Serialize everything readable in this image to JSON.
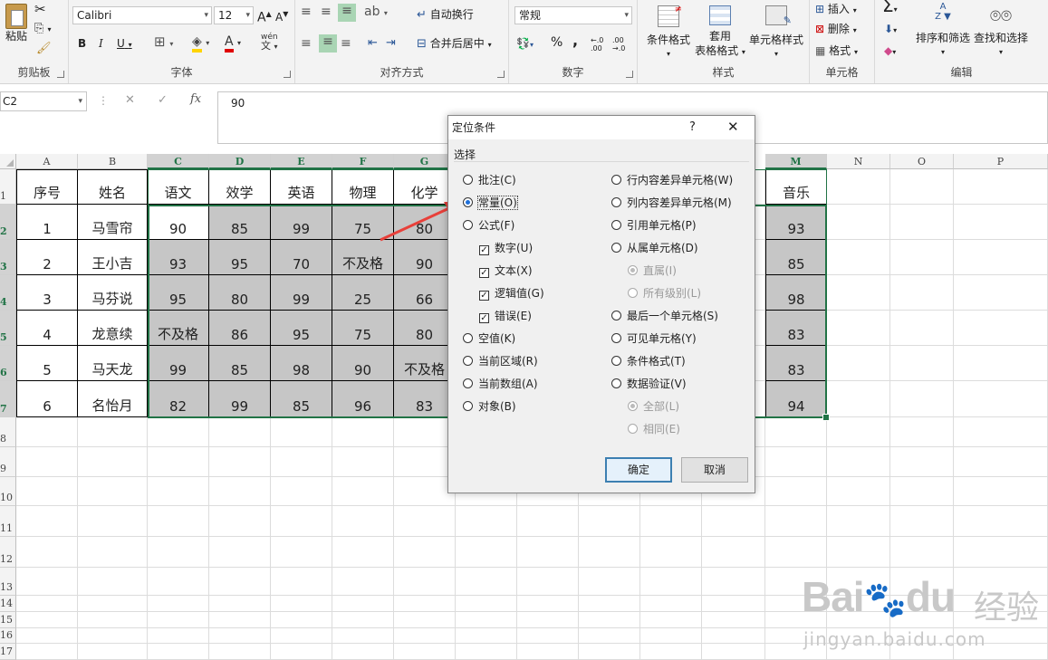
{
  "ribbon": {
    "clipboard": {
      "paste": "粘贴",
      "label": "剪贴板"
    },
    "font": {
      "name": "Calibri",
      "size": "12",
      "label": "字体",
      "bold": "B",
      "italic": "I",
      "underline": "U",
      "grow": "A",
      "shrink": "A",
      "color": "A",
      "phonetic": "wén"
    },
    "alignment": {
      "wrap": "自动换行",
      "merge": "合并后居中",
      "label": "对齐方式"
    },
    "number": {
      "format": "常规",
      "label": "数字",
      "percent": "%",
      "comma": ",",
      "inc": "←.0 .00",
      "dec": ".00 →.0"
    },
    "styles": {
      "conditional": "条件格式",
      "table_line1": "套用",
      "table_line2": "表格格式",
      "cell_styles": "单元格样式",
      "label": "样式"
    },
    "cells": {
      "insert": "插入",
      "delete": "删除",
      "format": "格式",
      "label": "单元格"
    },
    "editing": {
      "sigma": "Σ",
      "sort": "排序和筛选",
      "find": "查找和选择",
      "label": "编辑"
    }
  },
  "formula_bar": {
    "name_box": "C2",
    "cancel": "✕",
    "enter": "✓",
    "fx": "fx",
    "value": "90"
  },
  "columns": [
    "A",
    "B",
    "C",
    "D",
    "E",
    "F",
    "G",
    "N",
    "O",
    "P"
  ],
  "selected_last_col": "M",
  "rows": [
    {
      "n": "1",
      "cells": [
        "序号",
        "姓名",
        "语文",
        "效学",
        "英语",
        "物理",
        "化学"
      ],
      "last": "音乐"
    },
    {
      "n": "2",
      "cells": [
        "1",
        "马雪帘",
        "90",
        "85",
        "99",
        "75",
        "80"
      ],
      "last": "93"
    },
    {
      "n": "3",
      "cells": [
        "2",
        "王小吉",
        "93",
        "95",
        "70",
        "不及格",
        "90"
      ],
      "last": "85"
    },
    {
      "n": "4",
      "cells": [
        "3",
        "马芬说",
        "95",
        "80",
        "99",
        "25",
        "66"
      ],
      "last": "98"
    },
    {
      "n": "5",
      "cells": [
        "4",
        "龙意续",
        "不及格",
        "86",
        "95",
        "75",
        "80"
      ],
      "last": "83"
    },
    {
      "n": "6",
      "cells": [
        "5",
        "马天龙",
        "99",
        "85",
        "98",
        "90",
        "不及格"
      ],
      "last": "83"
    },
    {
      "n": "7",
      "cells": [
        "6",
        "名怡月",
        "82",
        "99",
        "85",
        "96",
        "83"
      ],
      "last": "94"
    }
  ],
  "empty_rows": [
    "8",
    "9",
    "10",
    "11",
    "12",
    "13",
    "14",
    "15",
    "16",
    "17"
  ],
  "dialog": {
    "title": "定位条件",
    "help": "?",
    "close": "✕",
    "section": "选择",
    "left_options": [
      {
        "label": "批注(C)",
        "type": "radio",
        "on": false
      },
      {
        "label": "常量(O)",
        "type": "radio",
        "on": true
      },
      {
        "label": "公式(F)",
        "type": "radio",
        "on": false
      },
      {
        "label": "数字(U)",
        "type": "check",
        "on": true,
        "indent": true
      },
      {
        "label": "文本(X)",
        "type": "check",
        "on": true,
        "indent": true
      },
      {
        "label": "逻辑值(G)",
        "type": "check",
        "on": true,
        "indent": true
      },
      {
        "label": "错误(E)",
        "type": "check",
        "on": true,
        "indent": true
      },
      {
        "label": "空值(K)",
        "type": "radio",
        "on": false
      },
      {
        "label": "当前区域(R)",
        "type": "radio",
        "on": false
      },
      {
        "label": "当前数组(A)",
        "type": "radio",
        "on": false
      },
      {
        "label": "对象(B)",
        "type": "radio",
        "on": false
      }
    ],
    "right_options": [
      {
        "label": "行内容差异单元格(W)",
        "type": "radio",
        "on": false
      },
      {
        "label": "列内容差异单元格(M)",
        "type": "radio",
        "on": false
      },
      {
        "label": "引用单元格(P)",
        "type": "radio",
        "on": false
      },
      {
        "label": "从属单元格(D)",
        "type": "radio",
        "on": false
      },
      {
        "label": "直属(I)",
        "type": "radio",
        "on": true,
        "indent": true,
        "disabled": true
      },
      {
        "label": "所有级别(L)",
        "type": "radio",
        "on": false,
        "indent": true,
        "disabled": true
      },
      {
        "label": "最后一个单元格(S)",
        "type": "radio",
        "on": false
      },
      {
        "label": "可见单元格(Y)",
        "type": "radio",
        "on": false
      },
      {
        "label": "条件格式(T)",
        "type": "radio",
        "on": false
      },
      {
        "label": "数据验证(V)",
        "type": "radio",
        "on": false
      },
      {
        "label": "全部(L)",
        "type": "radio",
        "on": true,
        "indent": true,
        "disabled": true
      },
      {
        "label": "相同(E)",
        "type": "radio",
        "on": false,
        "indent": true,
        "disabled": true
      }
    ],
    "ok": "确定",
    "cancel": "取消"
  },
  "watermark": {
    "brand": "Bai",
    "brand2": "du",
    "cn": "经验",
    "url": "jingyan.baidu.com"
  },
  "colors": {
    "accent": "#217346",
    "highlight": "#c6c6c6",
    "arrow": "#e8403a"
  }
}
